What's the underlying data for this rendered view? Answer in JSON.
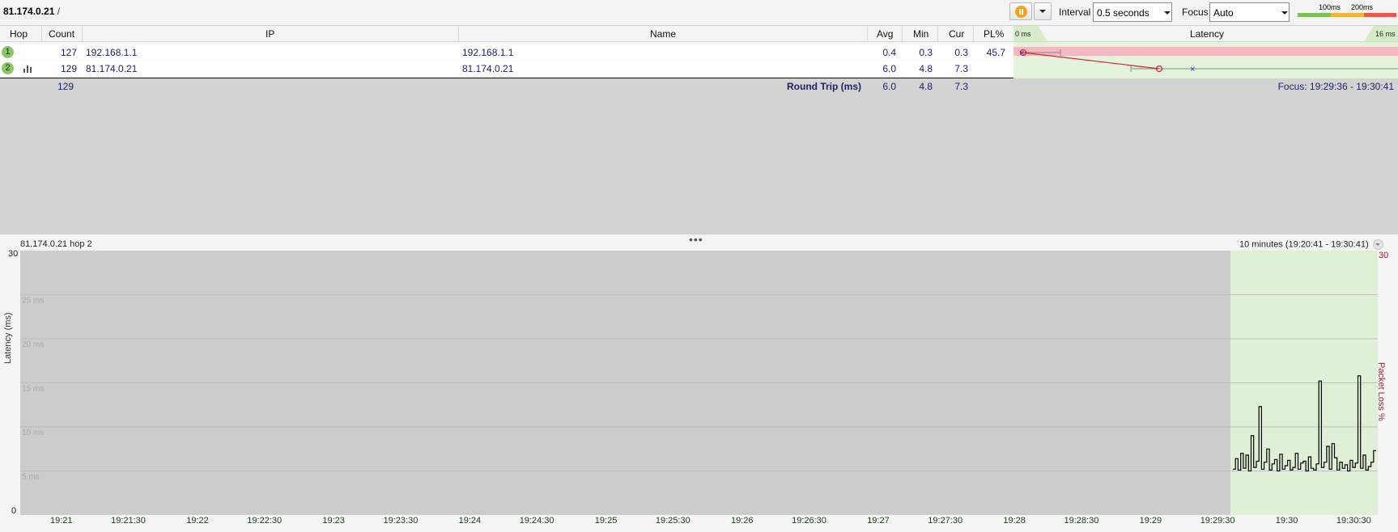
{
  "toolbar": {
    "target": "81.174.0.21",
    "separator": "/",
    "interval_label": "Interval",
    "interval_value": "0.5 seconds",
    "focus_label": "Focus",
    "focus_value": "Auto",
    "legend_100": "100ms",
    "legend_200": "200ms",
    "legend_colors": [
      "#7bc25a",
      "#f0b43a",
      "#e85a4a"
    ]
  },
  "table": {
    "headers": {
      "hop": "Hop",
      "count": "Count",
      "ip": "IP",
      "name": "Name",
      "avg": "Avg",
      "min": "Min",
      "cur": "Cur",
      "pl": "PL%",
      "lat_min": "0 ms",
      "lat_title": "Latency",
      "lat_max": "16 ms"
    },
    "rows": [
      {
        "hop": "1",
        "count": "127",
        "ip": "192.168.1.1",
        "name": "192.168.1.1",
        "avg": "0.4",
        "min": "0.3",
        "cur": "0.3",
        "pl": "45.7"
      },
      {
        "hop": "2",
        "count": "129",
        "ip": "81.174.0.21",
        "name": "81.174.0.21",
        "avg": "6.0",
        "min": "4.8",
        "cur": "7.3",
        "pl": ""
      }
    ],
    "summary": {
      "count": "129",
      "label": "Round Trip (ms)",
      "avg": "6.0",
      "min": "4.8",
      "cur": "7.3",
      "focus": "Focus: 19:29:36 - 19:30:41"
    }
  },
  "graph": {
    "title": "81.174.0.21 hop 2",
    "range": "10 minutes (19:20:41 - 19:30:41)",
    "y_title": "Latency (ms)",
    "pl_title": "Packet Loss %",
    "y_max": "30",
    "y_min": "0",
    "pl_max": "30",
    "gridlines": [
      "25 ms",
      "20 ms",
      "15 ms",
      "10 ms",
      "5 ms"
    ],
    "x_ticks": [
      "19:21",
      "19:21:30",
      "19:22",
      "19:22:30",
      "19:23",
      "19:23:30",
      "19:24",
      "19:24:30",
      "19:25",
      "19:25:30",
      "19:26",
      "19:26:30",
      "19:27",
      "19:27:30",
      "19:28",
      "19:28:30",
      "19:29",
      "19:29:30",
      "19:30",
      "19:30:30"
    ]
  },
  "chart_data": {
    "type": "line",
    "ylabel": "Latency (ms)",
    "ylim": [
      0,
      30
    ],
    "series": [
      {
        "values": [
          5.2,
          6.4,
          5.1,
          7.0,
          5.3,
          6.8,
          5.0,
          9.0,
          5.4,
          6.1,
          12.3,
          5.2,
          6.0,
          7.5,
          5.1,
          5.8,
          6.3,
          5.0,
          6.9,
          5.2,
          5.6,
          6.2,
          5.1,
          5.4,
          7.0,
          5.2,
          5.9,
          6.1,
          5.0,
          6.6,
          5.3,
          5.1,
          5.8,
          15.2,
          5.4,
          6.0,
          7.8,
          5.2,
          8.1,
          6.5,
          5.1,
          6.0,
          5.3,
          5.7,
          5.0,
          6.2,
          5.4,
          5.9,
          15.8,
          5.3,
          6.8,
          5.1,
          5.5,
          6.0,
          7.3
        ]
      }
    ]
  }
}
